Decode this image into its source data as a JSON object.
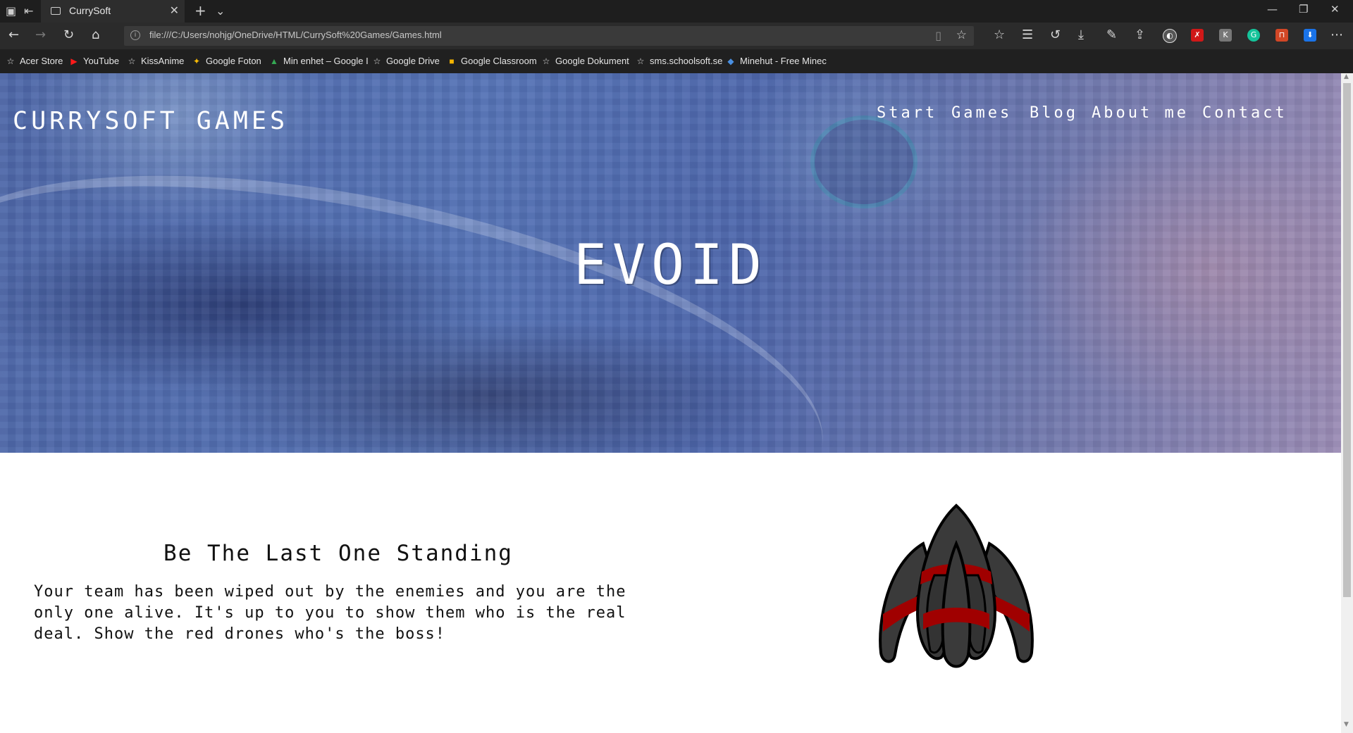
{
  "browser": {
    "tab_title": "CurrySoft",
    "url": "file:///C:/Users/nohjg/OneDrive/HTML/CurrySoft%20Games/Games.html",
    "bookmarks": [
      {
        "label": "Acer Store",
        "icon": "star-icon"
      },
      {
        "label": "YouTube",
        "icon": "youtube-icon"
      },
      {
        "label": "KissAnime",
        "icon": "star-icon"
      },
      {
        "label": "Google Foton",
        "icon": "google-photos-icon"
      },
      {
        "label": "Min enhet – Google I",
        "icon": "google-drive-icon"
      },
      {
        "label": "Google Drive",
        "icon": "star-icon"
      },
      {
        "label": "Google Classroom",
        "icon": "google-classroom-icon"
      },
      {
        "label": "Google Dokument",
        "icon": "star-icon"
      },
      {
        "label": "sms.schoolsoft.se",
        "icon": "star-icon"
      },
      {
        "label": "Minehut - Free Minec",
        "icon": "minehut-icon"
      }
    ]
  },
  "site": {
    "logo": "CURRYSOFT GAMES",
    "nav": [
      "Start",
      "Games",
      "Blog",
      "About me",
      "Contact"
    ],
    "hero_title": "EVOID"
  },
  "content": {
    "heading": "Be The Last One Standing",
    "paragraph": "Your team has been wiped out by the enemies and you are the only one alive. It's up to you to show them who is the real deal. Show the red drones who's the boss!"
  },
  "colors": {
    "ship_body": "#3a3a3a",
    "ship_stripe": "#a00000",
    "hero_base": "#5573b6"
  }
}
